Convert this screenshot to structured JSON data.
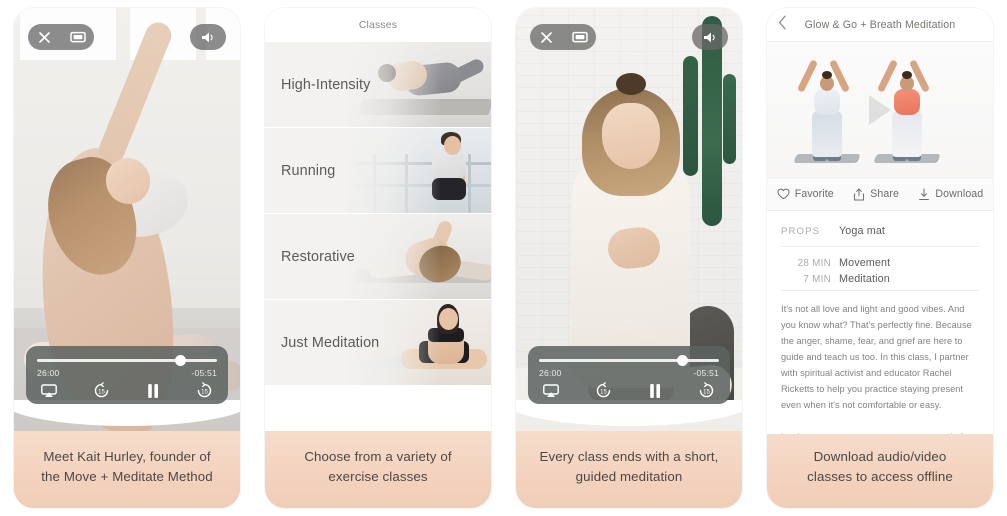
{
  "page": {
    "background": "#ffffff",
    "caption_bg": "#f2d2bd",
    "caption_text_color": "#4c4846"
  },
  "panels": [
    {
      "id": "player-intro",
      "type": "video-player",
      "caption": "Meet Kait Hurley, founder of the Move + Meditate Method",
      "caption_lines": [
        "Meet Kait Hurley, founder of",
        "the Move + Meditate Method"
      ],
      "controls": {
        "close_icon": "close-icon",
        "fullscreen_icon": "screen-icon",
        "volume_icon": "speaker-icon"
      },
      "player": {
        "elapsed": "26:00",
        "remaining": "-05:51",
        "progress_percent": 77,
        "airplay_icon": "airplay-icon",
        "rewind_label": "15",
        "pause_icon": "pause-icon",
        "forward_label": "15"
      }
    },
    {
      "id": "class-list",
      "type": "list",
      "header_title": "Classes",
      "caption": "Choose from a variety of exercise classes",
      "caption_lines": [
        "Choose from a variety of",
        "exercise classes"
      ],
      "rows": [
        {
          "label": "High-Intensity"
        },
        {
          "label": "Running"
        },
        {
          "label": "Restorative"
        },
        {
          "label": "Just Meditation"
        }
      ]
    },
    {
      "id": "player-meditation",
      "type": "video-player",
      "caption": "Every class ends with a short, guided meditation",
      "caption_lines": [
        "Every class ends with a short,",
        "guided meditation"
      ],
      "controls": {
        "close_icon": "close-icon",
        "fullscreen_icon": "screen-icon",
        "volume_icon": "speaker-icon"
      },
      "player": {
        "elapsed": "26:00",
        "remaining": "-05:51",
        "progress_percent": 77,
        "airplay_icon": "airplay-icon",
        "rewind_label": "15",
        "pause_icon": "pause-icon",
        "forward_label": "15"
      }
    },
    {
      "id": "class-detail",
      "type": "detail",
      "header_title": "Glow & Go + Breath Meditation",
      "back_icon": "chevron-left-icon",
      "play_icon": "play-icon",
      "actions": [
        {
          "label": "Favorite",
          "icon": "heart-icon"
        },
        {
          "label": "Share",
          "icon": "share-icon"
        },
        {
          "label": "Download",
          "icon": "download-icon"
        }
      ],
      "props": {
        "key": "PROPS",
        "value": "Yoga mat"
      },
      "durations": [
        {
          "amount": "28",
          "unit": "MIN",
          "label": "Movement"
        },
        {
          "amount": "7",
          "unit": "MIN",
          "label": "Meditation"
        }
      ],
      "description": "It's not all love and light and good vibes. And you know what? That's perfectly fine. Because the anger, shame, fear, and grief are here to guide and teach us too. In this class, I partner with spiritual activist and educator Rachel Ricketts to help you practice staying present even when it's not comfortable or easy. Because when you can stay present when it's hard, you respond to stress better instead of getting",
      "caption": "Download audio/video classes to access offline",
      "caption_lines": [
        "Download audio/video",
        "classes to access offline"
      ]
    }
  ]
}
